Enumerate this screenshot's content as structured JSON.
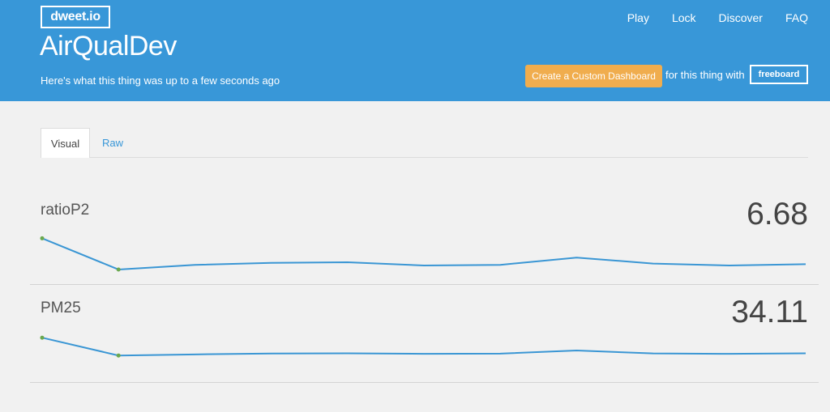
{
  "header": {
    "logo": "dweet.io",
    "nav": [
      "Play",
      "Lock",
      "Discover",
      "FAQ"
    ],
    "title": "AirQualDev",
    "subtitle": "Here's what this thing was up to a few seconds ago",
    "dashboard_button": "Create a Custom Dashboard",
    "for_text": "for this thing with",
    "freeboard": "freeboard"
  },
  "tabs": [
    "Visual",
    "Raw"
  ],
  "metrics": [
    {
      "name": "ratioP2",
      "value": "6.68",
      "spark": [
        6.9,
        2.2,
        2.9,
        3.2,
        3.3,
        2.8,
        2.9,
        4.0,
        3.1,
        2.8,
        3.0
      ],
      "range": [
        0,
        10
      ]
    },
    {
      "name": "PM25",
      "value": "34.11",
      "spark": [
        40.1,
        24.0,
        25.0,
        25.8,
        26.0,
        25.5,
        25.7,
        28.5,
        25.9,
        25.5,
        26.0
      ],
      "range": [
        0,
        60
      ]
    }
  ]
}
